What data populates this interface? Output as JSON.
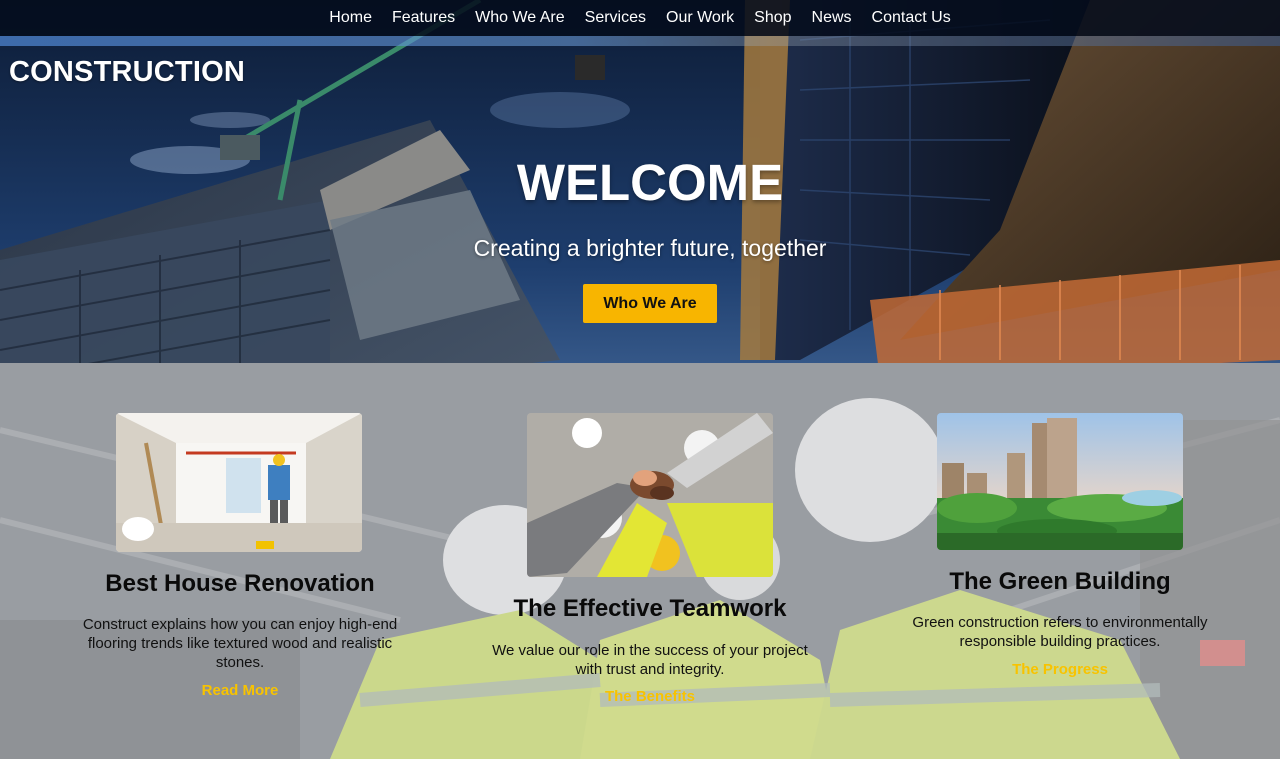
{
  "nav": {
    "items": [
      "Home",
      "Features",
      "Who We Are",
      "Services",
      "Our Work",
      "Shop",
      "News",
      "Contact Us"
    ]
  },
  "brand": "CONSTRUCTION",
  "hero": {
    "title": "WELCOME",
    "subtitle": "Creating a brighter future, together",
    "button_label": "Who We Are"
  },
  "cards": [
    {
      "title": "Best House Renovation",
      "text": "Construct explains how you can enjoy high-end flooring trends like textured wood and realistic stones.",
      "link": "Read More"
    },
    {
      "title": "The Effective Teamwork",
      "text": "We value our role in the success of your project with trust and integrity.",
      "link": "The Benefits"
    },
    {
      "title": "The Green Building",
      "text": "Green construction refers to environmentally responsible building practices.",
      "link": "The Progress"
    }
  ],
  "colors": {
    "accent": "#f8b500",
    "link": "#f8c300",
    "nav_bg": "#050c1c"
  }
}
